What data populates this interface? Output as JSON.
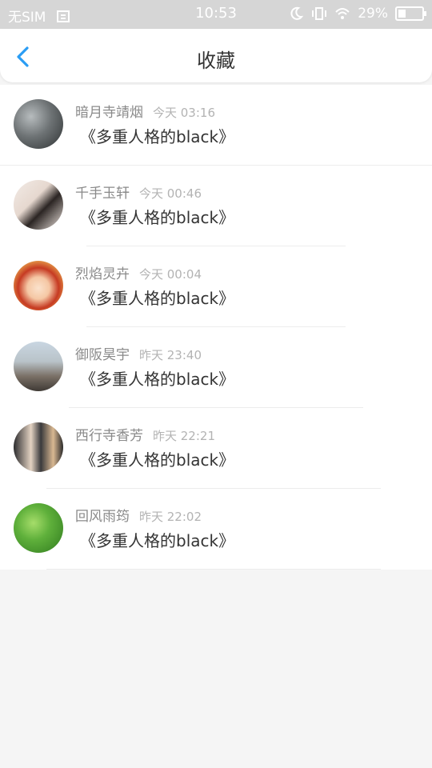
{
  "status_bar": {
    "carrier": "无SIM",
    "time": "10:53",
    "battery": "29%"
  },
  "nav": {
    "title": "收藏"
  },
  "favorites": [
    {
      "name": "暗月寺靖烟",
      "time": "今天 03:16",
      "title": "《多重人格的black》"
    },
    {
      "name": "千手玉轩",
      "time": "今天 00:46",
      "title": "《多重人格的black》"
    },
    {
      "name": "烈焰灵卉",
      "time": "今天 00:04",
      "title": "《多重人格的black》"
    },
    {
      "name": "御阪昊宇",
      "time": "昨天 23:40",
      "title": "《多重人格的black》"
    },
    {
      "name": "西行寺香芳",
      "time": "昨天 22:21",
      "title": "《多重人格的black》"
    },
    {
      "name": "回风雨筠",
      "time": "昨天 22:02",
      "title": "《多重人格的black》"
    }
  ],
  "colors": {
    "accent": "#2a9df4",
    "name": "#8a8a8a",
    "time": "#b3b3b3",
    "title": "#333333"
  }
}
